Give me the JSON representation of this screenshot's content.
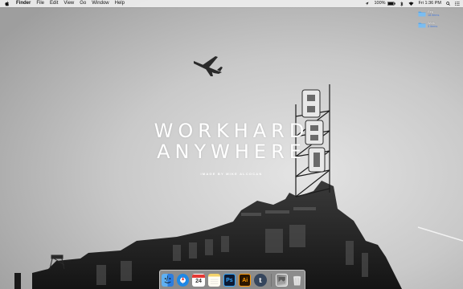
{
  "menubar": {
    "apple_icon": "apple-icon",
    "app_name": "Finder",
    "menus": [
      "File",
      "Edit",
      "View",
      "Go",
      "Window",
      "Help"
    ],
    "status": {
      "location_icon": "location-arrow-icon",
      "battery": "100%",
      "battery_icon": "battery-icon",
      "bluetooth_icon": "bluetooth-icon",
      "wifi_icon": "wifi-icon",
      "clock": "Fri 1:36 PM",
      "spotlight_icon": "search-icon",
      "list_icon": "notification-center-icon"
    }
  },
  "desktop": {
    "folders": [
      {
        "name": "Req",
        "detail": "18 items",
        "icon": "folder-icon"
      },
      {
        "name": "Work",
        "detail": "3 items",
        "icon": "folder-icon"
      }
    ],
    "wallpaper": {
      "headline_line1": "WORKHARD",
      "headline_line2": "ANYWHERE",
      "credit": "IMAGE BY MIKE ALCOCAN"
    }
  },
  "dock": {
    "apps": [
      {
        "name": "Finder",
        "icon": "finder-icon"
      },
      {
        "name": "Safari",
        "icon": "safari-icon"
      },
      {
        "name": "Calendar",
        "icon": "calendar-icon",
        "label": "24"
      },
      {
        "name": "Notes",
        "icon": "notes-icon"
      },
      {
        "name": "Photoshop",
        "icon": "photoshop-icon",
        "label": "Ps"
      },
      {
        "name": "Illustrator",
        "icon": "illustrator-icon",
        "label": "Ai"
      },
      {
        "name": "Tumblr",
        "icon": "tumblr-icon",
        "label": "t"
      },
      {
        "name": "Preview",
        "icon": "preview-icon"
      },
      {
        "name": "Trash",
        "icon": "trash-icon"
      }
    ]
  },
  "colors": {
    "menubar_bg": "#eeeeee",
    "folder_blue": "#5aa7e8",
    "wallpaper_text": "#ffffff"
  }
}
